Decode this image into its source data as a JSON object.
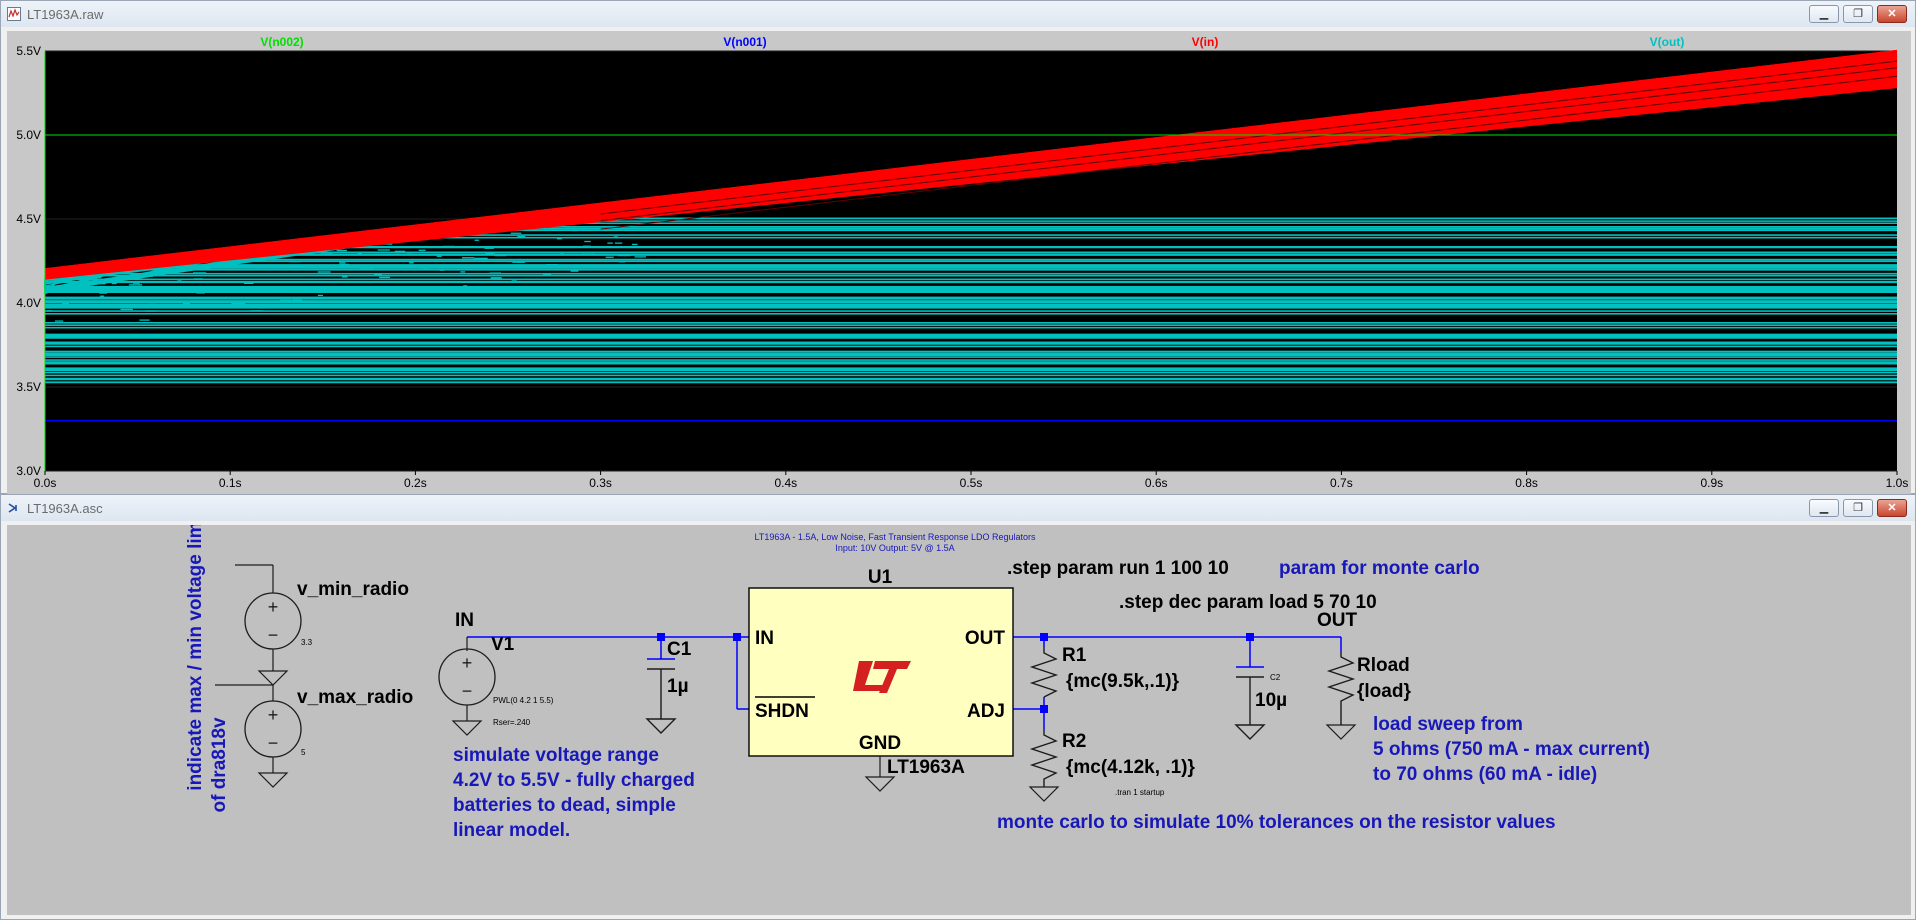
{
  "plot_window": {
    "title": "LT1963A.raw",
    "traces": [
      {
        "name": "V(n002)",
        "color": "#00e000"
      },
      {
        "name": "V(n001)",
        "color": "#0000ff"
      },
      {
        "name": "V(in)",
        "color": "#ff0000"
      },
      {
        "name": "V(out)",
        "color": "#00c0c0"
      }
    ],
    "y_ticks": [
      "5.5V",
      "5.0V",
      "4.5V",
      "4.0V",
      "3.5V",
      "3.0V"
    ],
    "x_ticks": [
      "0.0s",
      "0.1s",
      "0.2s",
      "0.3s",
      "0.4s",
      "0.5s",
      "0.6s",
      "0.7s",
      "0.8s",
      "0.9s",
      "1.0s"
    ]
  },
  "chart_data": {
    "type": "line",
    "xlabel": "",
    "ylabel": "",
    "xlim": [
      0,
      1.0
    ],
    "ylim": [
      3.0,
      5.5
    ],
    "series": [
      {
        "name": "V(n002)",
        "x": [
          0,
          1.0
        ],
        "values": [
          5.0,
          5.0
        ]
      },
      {
        "name": "V(n001)",
        "x": [
          0,
          1.0
        ],
        "values": [
          3.3,
          3.3
        ]
      },
      {
        "name": "V(in)",
        "x": [
          0,
          1.0
        ],
        "values": [
          4.2,
          5.5
        ]
      },
      {
        "name": "V(out)",
        "x": [
          0,
          0.4,
          1.0
        ],
        "values": [
          4.1,
          4.5,
          4.55
        ]
      }
    ]
  },
  "schematic_window": {
    "title": "LT1963A.asc",
    "header_line1": "LT1963A - 1.5A, Low Noise, Fast Transient Response LDO Regulators",
    "header_line2": "Input: 10V    Output: 5V @ 1.5A",
    "step_run": ".step param run 1 100 10",
    "step_run_comment": "param for monte carlo",
    "step_load": ".step dec param load 5 70 10",
    "vertical_note_line1": "indicate max / min voltage limits",
    "vertical_note_line2": "of dra818v",
    "v_min_label": "v_min_radio",
    "v_min_value": "3.3",
    "v_max_label": "v_max_radio",
    "v_max_value": "5",
    "in_net": "IN",
    "v1_label": "V1",
    "v1_pwl": "PWL(0 4.2 1 5.5)",
    "v1_rser": "Rser=.240",
    "c1_label": "C1",
    "c1_value": "1µ",
    "u1_label": "U1",
    "pin_in": "IN",
    "pin_out": "OUT",
    "pin_shdn": "SHDN",
    "pin_adj": "ADJ",
    "pin_gnd": "GND",
    "part_name": "LT1963A",
    "r1_label": "R1",
    "r1_value": "{mc(9.5k,.1)}",
    "r2_label": "R2",
    "r2_value": "{mc(4.12k, .1)}",
    "c2_label": "C2",
    "c2_value": "10µ",
    "out_net": "OUT",
    "rload_label": "Rload",
    "rload_value": "{load}",
    "tran_directive": ".tran 1 startup",
    "sim_note_line1": "simulate voltage range",
    "sim_note_line2": "4.2V to 5.5V - fully charged",
    "sim_note_line3": "batteries to dead, simple",
    "sim_note_line4": "linear model.",
    "load_note_line1": "load sweep from",
    "load_note_line2": "5 ohms (750 mA - max current)",
    "load_note_line3": "to 70 ohms (60 mA - idle)",
    "mc_note": "monte carlo to simulate 10% tolerances on the resistor values"
  },
  "colors": {
    "plot_bg": "#000000",
    "schematic_bg": "#c0c0c0",
    "wire": "#0000ff",
    "comment_text": "#1818b8",
    "component": "#1c1c1c",
    "ic_fill": "#ffffc0"
  }
}
